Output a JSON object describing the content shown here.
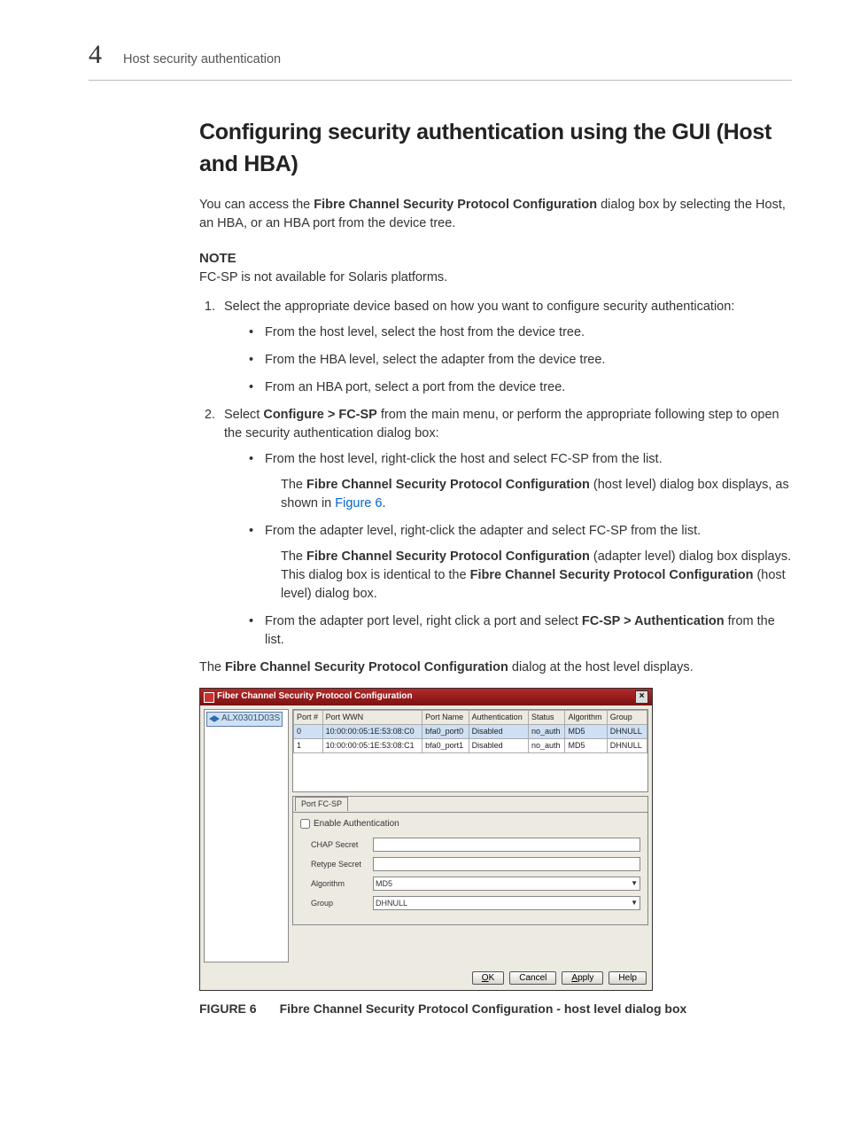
{
  "header": {
    "chapter_number": "4",
    "running_head": "Host security authentication"
  },
  "section_title": "Configuring security authentication using the GUI (Host and HBA)",
  "intro": {
    "pre": "You can access the ",
    "bold": "Fibre Channel Security Protocol Configuration",
    "post": " dialog box by selecting the Host, an HBA, or an HBA port from the device tree."
  },
  "note": {
    "label": "NOTE",
    "text": "FC-SP is not available for Solaris platforms."
  },
  "step1": {
    "text": "Select the appropriate device based on how you want to configure security authentication:",
    "bullets": [
      "From the host level, select the host from the device tree.",
      "From the HBA level, select the adapter from the device tree.",
      "From an HBA port, select a port from the device tree."
    ]
  },
  "step2": {
    "pre": "Select ",
    "bold": "Configure > FC-SP",
    "post": " from the main menu, or perform the appropriate following step to open the security authentication dialog box:",
    "b1": {
      "text": "From the host level, right-click the host and select FC-SP from the list.",
      "sub_pre": "The ",
      "sub_bold": "Fibre Channel Security Protocol Configuration",
      "sub_mid": " (host level) dialog box displays, as shown in ",
      "link": "Figure 6",
      "sub_end": "."
    },
    "b2": {
      "text": "From the adapter level, right-click the adapter and select FC-SP from the list.",
      "sub_pre": "The ",
      "sub_bold1": "Fibre Channel Security Protocol Configuration",
      "sub_mid1": " (adapter level) dialog box displays. This dialog box is identical to the ",
      "sub_bold2": "Fibre Channel Security Protocol Configuration",
      "sub_end": " (host level) dialog box."
    },
    "b3": {
      "pre": "From the adapter port level, right click a port and select ",
      "bold": "FC-SP > Authentication",
      "post": " from the list."
    }
  },
  "closing": {
    "pre": "The ",
    "bold": "Fibre Channel Security Protocol Configuration",
    "post": " dialog at the host level displays."
  },
  "dialog": {
    "title": "Fiber Channel Security Protocol Configuration",
    "tree_node": "ALX0301D03S",
    "columns": [
      "Port #",
      "Port WWN",
      "Port Name",
      "Authentication",
      "Status",
      "Algorithm",
      "Group"
    ],
    "rows": [
      {
        "port": "0",
        "wwn": "10:00:00:05:1E:53:08:C0",
        "name": "bfa0_port0",
        "auth": "Disabled",
        "status": "no_auth",
        "alg": "MD5",
        "group": "DHNULL"
      },
      {
        "port": "1",
        "wwn": "10:00:00:05:1E:53:08:C1",
        "name": "bfa0_port1",
        "auth": "Disabled",
        "status": "no_auth",
        "alg": "MD5",
        "group": "DHNULL"
      }
    ],
    "tab": "Port FC-SP",
    "enable_label": "Enable Authentication",
    "form": {
      "chap_label": "CHAP Secret",
      "retype_label": "Retype Secret",
      "algorithm_label": "Algorithm",
      "algorithm_value": "MD5",
      "group_label": "Group",
      "group_value": "DHNULL"
    },
    "buttons": {
      "ok": "OK",
      "cancel": "Cancel",
      "apply": "Apply",
      "help": "Help"
    }
  },
  "figure": {
    "label": "FIGURE 6",
    "caption": "Fibre Channel Security Protocol Configuration - host level dialog box"
  }
}
